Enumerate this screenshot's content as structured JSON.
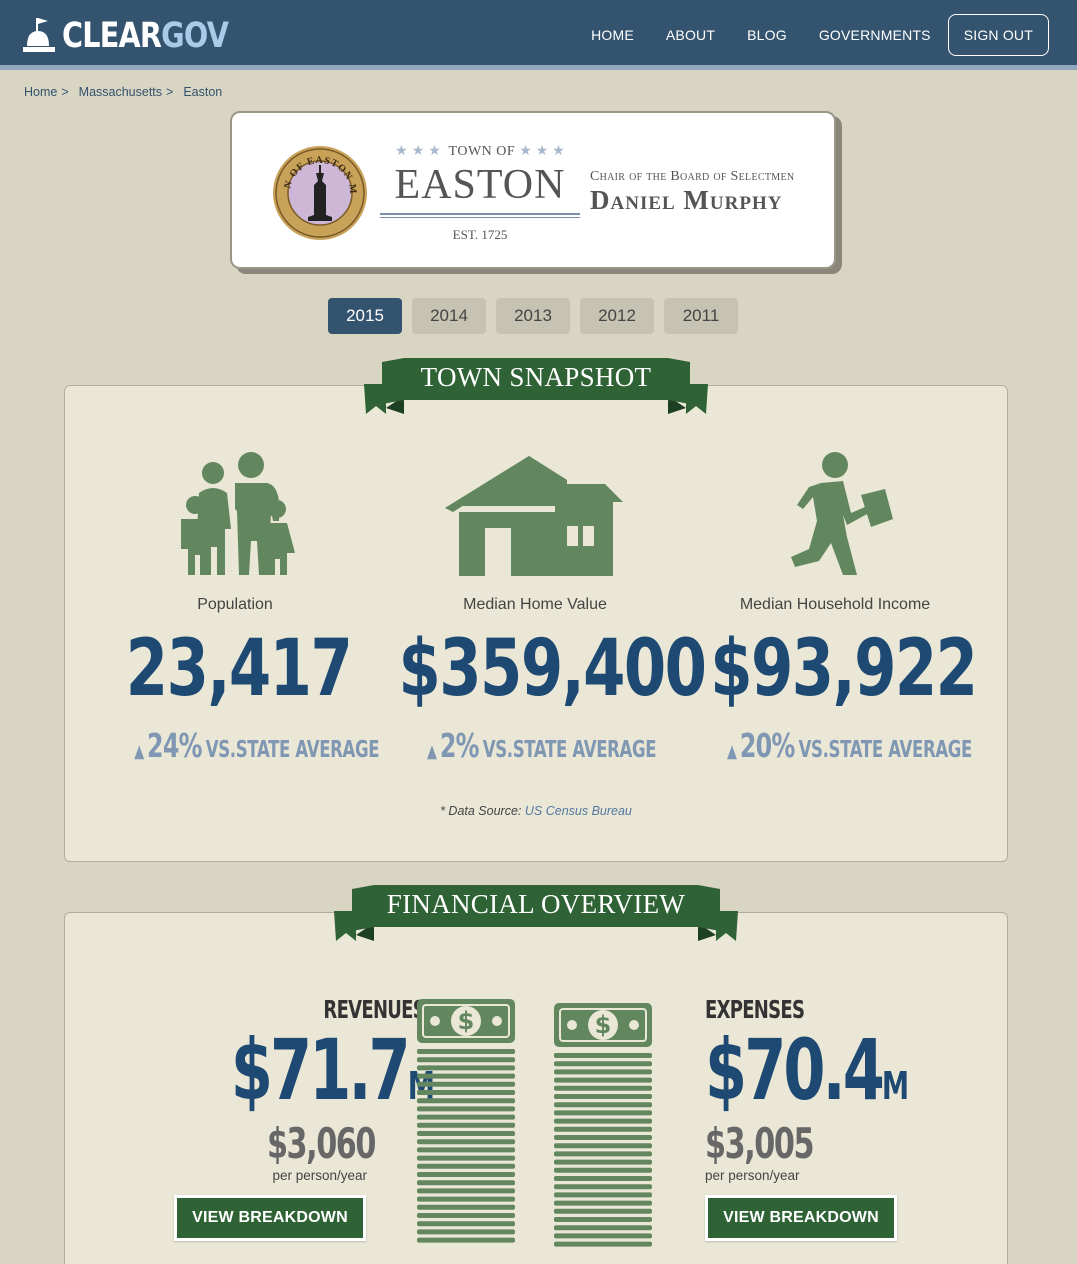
{
  "header": {
    "logo_clear": "CLEAR",
    "logo_gov": "GOV",
    "nav": [
      "HOME",
      "ABOUT",
      "BLOG",
      "GOVERNMENTS"
    ],
    "signout": "SIGN OUT"
  },
  "breadcrumb": [
    "Home",
    "Massachusetts",
    "Easton"
  ],
  "breadcrumb_sep": ">",
  "town": {
    "town_of": "TOWN OF",
    "name": "EASTON",
    "est": "EST. 1725",
    "chair_title": "Chair of the Board of Selectmen",
    "chair_name": "Daniel Murphy",
    "seal_text": "TOWN OF EASTON MASS"
  },
  "years": [
    "2015",
    "2014",
    "2013",
    "2012",
    "2011"
  ],
  "active_year": "2015",
  "snapshot": {
    "title": "TOWN SNAPSHOT",
    "stats": [
      {
        "label": "Population",
        "value": "23,417",
        "pct": "24%",
        "compare": "VS.STATE AVERAGE",
        "icon": "family-icon"
      },
      {
        "label": "Median Home Value",
        "value": "$359,400",
        "pct": "2%",
        "compare": "VS.STATE AVERAGE",
        "icon": "house-icon"
      },
      {
        "label": "Median Household Income",
        "value": "$93,922",
        "pct": "20%",
        "compare": "VS.STATE AVERAGE",
        "icon": "worker-icon"
      }
    ],
    "source_prefix": "* Data Source:",
    "source_link": "US Census Bureau"
  },
  "financial": {
    "title": "FINANCIAL OVERVIEW",
    "revenues": {
      "label": "REVENUES",
      "value": "$71.7",
      "unit": "M",
      "per_person": "$3,060",
      "per_person_label": "per person/year",
      "button": "VIEW BREAKDOWN"
    },
    "expenses": {
      "label": "EXPENSES",
      "value": "$70.4",
      "unit": "M",
      "per_person": "$3,005",
      "per_person_label": "per person/year",
      "button": "VIEW BREAKDOWN"
    }
  },
  "colors": {
    "navbar": "#34536e",
    "accent_green": "#2f6336",
    "icon_green": "#62875f",
    "value_blue": "#1d4973",
    "compare_blue": "#7f97b3",
    "background": "#d8d5c3",
    "panel": "#eae7d6"
  }
}
